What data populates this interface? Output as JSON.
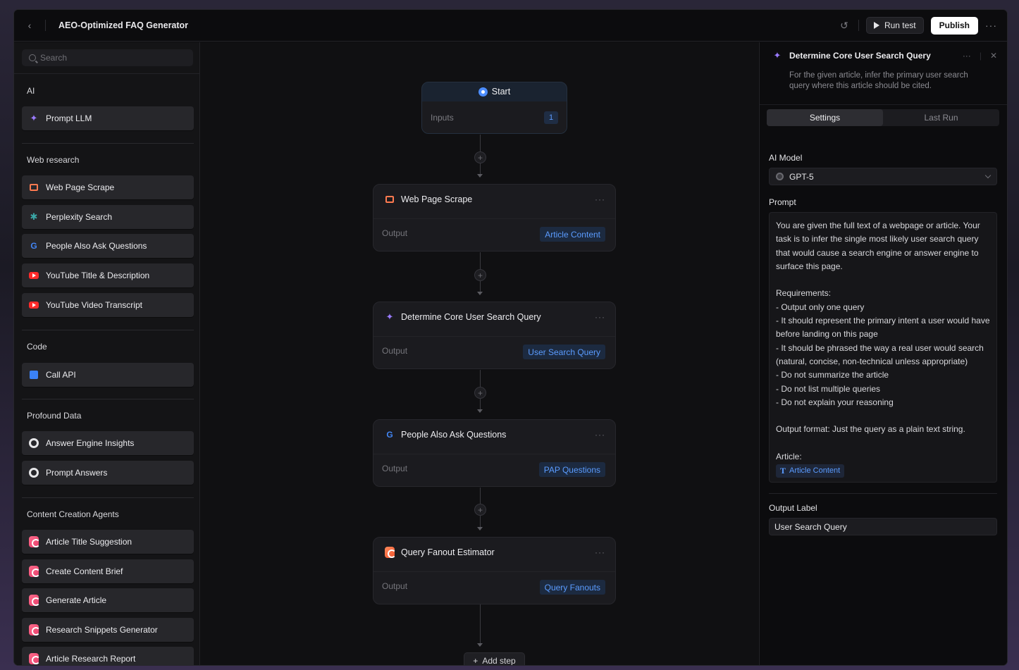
{
  "header": {
    "back_icon": "chevron-left-icon",
    "title": "AEO-Optimized FAQ Generator",
    "history_icon": "history-icon",
    "run_test_label": "Run test",
    "publish_label": "Publish",
    "more_label": "…"
  },
  "sidebar": {
    "search_placeholder": "Search",
    "sections": [
      {
        "heading": "AI",
        "items": [
          {
            "label": "Prompt LLM",
            "icon": "sparkle-icon"
          }
        ]
      },
      {
        "heading": "Web research",
        "items": [
          {
            "label": "Web Page Scrape",
            "icon": "web-scrape-icon"
          },
          {
            "label": "Perplexity Search",
            "icon": "perplexity-icon"
          },
          {
            "label": "People Also Ask Questions",
            "icon": "google-icon"
          },
          {
            "label": "YouTube Title & Description",
            "icon": "youtube-icon"
          },
          {
            "label": "YouTube Video Transcript",
            "icon": "youtube-icon"
          }
        ]
      },
      {
        "heading": "Code",
        "items": [
          {
            "label": "Call API",
            "icon": "api-icon"
          }
        ]
      },
      {
        "heading": "Profound Data",
        "items": [
          {
            "label": "Answer Engine Insights",
            "icon": "profound-icon"
          },
          {
            "label": "Prompt Answers",
            "icon": "profound-icon"
          }
        ]
      },
      {
        "heading": "Content Creation Agents",
        "items": [
          {
            "label": "Article Title Suggestion",
            "icon": "agent-icon"
          },
          {
            "label": "Create Content Brief",
            "icon": "agent-icon"
          },
          {
            "label": "Generate Article",
            "icon": "agent-icon"
          },
          {
            "label": "Research Snippets Generator",
            "icon": "agent-icon"
          },
          {
            "label": "Article Research Report",
            "icon": "agent-icon"
          }
        ]
      }
    ]
  },
  "canvas": {
    "start": {
      "label": "Start",
      "inputs_label": "Inputs",
      "inputs_count": "1"
    },
    "nodes": [
      {
        "title": "Web Page Scrape",
        "output_label": "Output",
        "output_tag": "Article Content",
        "icon": "web-scrape-icon"
      },
      {
        "title": "Determine Core User Search Query",
        "output_label": "Output",
        "output_tag": "User Search Query",
        "icon": "sparkle-icon"
      },
      {
        "title": "People Also Ask Questions",
        "output_label": "Output",
        "output_tag": "PAP Questions",
        "icon": "google-icon"
      },
      {
        "title": "Query Fanout Estimator",
        "output_label": "Output",
        "output_tag": "Query Fanouts",
        "icon": "query-fanout-icon"
      }
    ],
    "add_step_label": "Add step"
  },
  "panel": {
    "title": "Determine Core User Search Query",
    "description": "For the given article, infer the primary user search query where this article should be cited.",
    "tabs": [
      "Settings",
      "Last Run"
    ],
    "active_tab": "Settings",
    "ai_model_label": "AI Model",
    "ai_model_value": "GPT-5",
    "prompt_label": "Prompt",
    "prompt_text": "You are given the full text of a webpage or article. Your task is to infer the single most likely user search query that would cause a search engine or answer engine to surface this page.\n\nRequirements:\n- Output only one query\n- It should represent the primary intent a user would have before landing on this page\n- It should be phrased the way a real user would search (natural, concise, non-technical unless appropriate)\n- Do not summarize the article\n- Do not list multiple queries\n- Do not explain your reasoning\n\nOutput format: Just the query as a plain text string.\n\nArticle:",
    "prompt_variable": "Article Content",
    "output_label_heading": "Output Label",
    "output_label_value": "User Search Query"
  }
}
